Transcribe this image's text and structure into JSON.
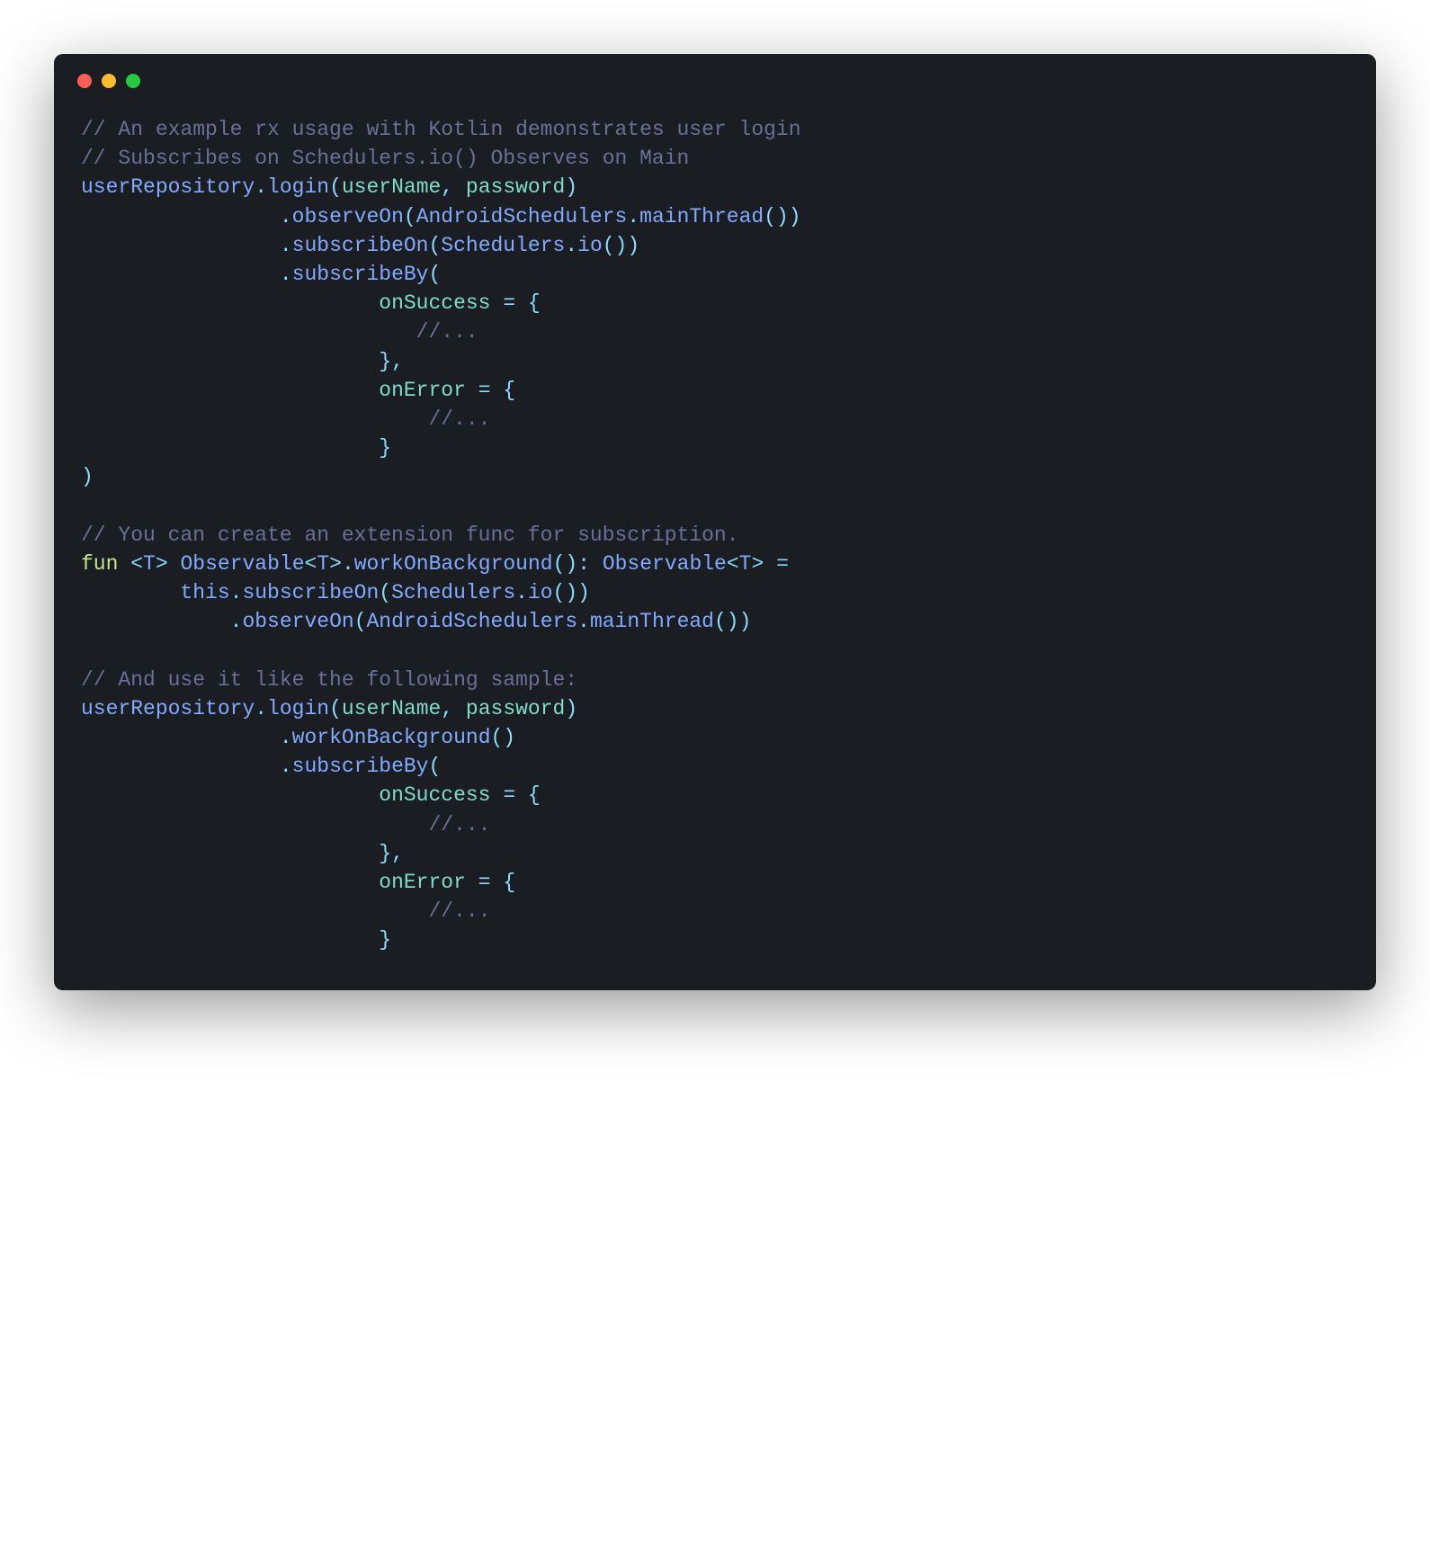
{
  "code": {
    "lines": [
      [
        {
          "t": "comment",
          "v": "// An example rx usage with Kotlin demonstrates user login"
        }
      ],
      [
        {
          "t": "comment",
          "v": "// Subscribes on Schedulers.io() Observes on Main"
        }
      ],
      [
        {
          "t": "ident",
          "v": "userRepository"
        },
        {
          "t": "punct",
          "v": "."
        },
        {
          "t": "ident",
          "v": "login"
        },
        {
          "t": "punct",
          "v": "("
        },
        {
          "t": "param",
          "v": "userName"
        },
        {
          "t": "punct",
          "v": ","
        },
        {
          "t": "plain",
          "v": " "
        },
        {
          "t": "param",
          "v": "password"
        },
        {
          "t": "punct",
          "v": ")"
        }
      ],
      [
        {
          "t": "plain",
          "v": "                "
        },
        {
          "t": "punct",
          "v": "."
        },
        {
          "t": "ident",
          "v": "observeOn"
        },
        {
          "t": "punct",
          "v": "("
        },
        {
          "t": "ident",
          "v": "AndroidSchedulers"
        },
        {
          "t": "punct",
          "v": "."
        },
        {
          "t": "ident",
          "v": "mainThread"
        },
        {
          "t": "punct",
          "v": "())"
        }
      ],
      [
        {
          "t": "plain",
          "v": "                "
        },
        {
          "t": "punct",
          "v": "."
        },
        {
          "t": "ident",
          "v": "subscribeOn"
        },
        {
          "t": "punct",
          "v": "("
        },
        {
          "t": "ident",
          "v": "Schedulers"
        },
        {
          "t": "punct",
          "v": "."
        },
        {
          "t": "ident",
          "v": "io"
        },
        {
          "t": "punct",
          "v": "())"
        }
      ],
      [
        {
          "t": "plain",
          "v": "                "
        },
        {
          "t": "punct",
          "v": "."
        },
        {
          "t": "ident",
          "v": "subscribeBy"
        },
        {
          "t": "punct",
          "v": "("
        }
      ],
      [
        {
          "t": "plain",
          "v": "                        "
        },
        {
          "t": "param",
          "v": "onSuccess"
        },
        {
          "t": "plain",
          "v": " "
        },
        {
          "t": "punct",
          "v": "="
        },
        {
          "t": "plain",
          "v": " "
        },
        {
          "t": "punct",
          "v": "{"
        }
      ],
      [
        {
          "t": "plain",
          "v": "                           "
        },
        {
          "t": "comment",
          "v": "//..."
        }
      ],
      [
        {
          "t": "plain",
          "v": "                        "
        },
        {
          "t": "punct",
          "v": "},"
        }
      ],
      [
        {
          "t": "plain",
          "v": "                        "
        },
        {
          "t": "param",
          "v": "onError"
        },
        {
          "t": "plain",
          "v": " "
        },
        {
          "t": "punct",
          "v": "="
        },
        {
          "t": "plain",
          "v": " "
        },
        {
          "t": "punct",
          "v": "{"
        }
      ],
      [
        {
          "t": "plain",
          "v": "                            "
        },
        {
          "t": "comment",
          "v": "//..."
        }
      ],
      [
        {
          "t": "plain",
          "v": "                        "
        },
        {
          "t": "punct",
          "v": "}"
        }
      ],
      [
        {
          "t": "punct",
          "v": ")"
        }
      ],
      [],
      [
        {
          "t": "comment",
          "v": "// You can create an extension func for subscription."
        }
      ],
      [
        {
          "t": "keyword",
          "v": "fun"
        },
        {
          "t": "plain",
          "v": " "
        },
        {
          "t": "punct",
          "v": "<"
        },
        {
          "t": "ident",
          "v": "T"
        },
        {
          "t": "punct",
          "v": ">"
        },
        {
          "t": "plain",
          "v": " "
        },
        {
          "t": "ident",
          "v": "Observable"
        },
        {
          "t": "punct",
          "v": "<"
        },
        {
          "t": "ident",
          "v": "T"
        },
        {
          "t": "punct",
          "v": ">."
        },
        {
          "t": "ident",
          "v": "workOnBackground"
        },
        {
          "t": "punct",
          "v": "():"
        },
        {
          "t": "plain",
          "v": " "
        },
        {
          "t": "ident",
          "v": "Observable"
        },
        {
          "t": "punct",
          "v": "<"
        },
        {
          "t": "ident",
          "v": "T"
        },
        {
          "t": "punct",
          "v": ">"
        },
        {
          "t": "plain",
          "v": " "
        },
        {
          "t": "punct",
          "v": "="
        }
      ],
      [
        {
          "t": "plain",
          "v": "        "
        },
        {
          "t": "ident",
          "v": "this"
        },
        {
          "t": "punct",
          "v": "."
        },
        {
          "t": "ident",
          "v": "subscribeOn"
        },
        {
          "t": "punct",
          "v": "("
        },
        {
          "t": "ident",
          "v": "Schedulers"
        },
        {
          "t": "punct",
          "v": "."
        },
        {
          "t": "ident",
          "v": "io"
        },
        {
          "t": "punct",
          "v": "())"
        }
      ],
      [
        {
          "t": "plain",
          "v": "            "
        },
        {
          "t": "punct",
          "v": "."
        },
        {
          "t": "ident",
          "v": "observeOn"
        },
        {
          "t": "punct",
          "v": "("
        },
        {
          "t": "ident",
          "v": "AndroidSchedulers"
        },
        {
          "t": "punct",
          "v": "."
        },
        {
          "t": "ident",
          "v": "mainThread"
        },
        {
          "t": "punct",
          "v": "())"
        }
      ],
      [],
      [
        {
          "t": "comment",
          "v": "// And use it like the following sample:"
        }
      ],
      [
        {
          "t": "ident",
          "v": "userRepository"
        },
        {
          "t": "punct",
          "v": "."
        },
        {
          "t": "ident",
          "v": "login"
        },
        {
          "t": "punct",
          "v": "("
        },
        {
          "t": "param",
          "v": "userName"
        },
        {
          "t": "punct",
          "v": ","
        },
        {
          "t": "plain",
          "v": " "
        },
        {
          "t": "param",
          "v": "password"
        },
        {
          "t": "punct",
          "v": ")"
        }
      ],
      [
        {
          "t": "plain",
          "v": "                "
        },
        {
          "t": "punct",
          "v": "."
        },
        {
          "t": "ident",
          "v": "workOnBackground"
        },
        {
          "t": "punct",
          "v": "()"
        }
      ],
      [
        {
          "t": "plain",
          "v": "                "
        },
        {
          "t": "punct",
          "v": "."
        },
        {
          "t": "ident",
          "v": "subscribeBy"
        },
        {
          "t": "punct",
          "v": "("
        }
      ],
      [
        {
          "t": "plain",
          "v": "                        "
        },
        {
          "t": "param",
          "v": "onSuccess"
        },
        {
          "t": "plain",
          "v": " "
        },
        {
          "t": "punct",
          "v": "="
        },
        {
          "t": "plain",
          "v": " "
        },
        {
          "t": "punct",
          "v": "{"
        }
      ],
      [
        {
          "t": "plain",
          "v": "                            "
        },
        {
          "t": "comment",
          "v": "//..."
        }
      ],
      [
        {
          "t": "plain",
          "v": "                        "
        },
        {
          "t": "punct",
          "v": "},"
        }
      ],
      [
        {
          "t": "plain",
          "v": "                        "
        },
        {
          "t": "param",
          "v": "onError"
        },
        {
          "t": "plain",
          "v": " "
        },
        {
          "t": "punct",
          "v": "="
        },
        {
          "t": "plain",
          "v": " "
        },
        {
          "t": "punct",
          "v": "{"
        }
      ],
      [
        {
          "t": "plain",
          "v": "                            "
        },
        {
          "t": "comment",
          "v": "//..."
        }
      ],
      [
        {
          "t": "plain",
          "v": "                        "
        },
        {
          "t": "punct",
          "v": "}"
        }
      ]
    ]
  }
}
